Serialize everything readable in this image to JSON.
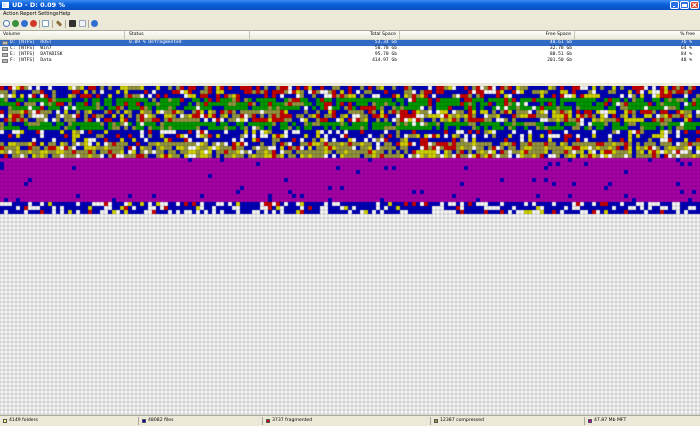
{
  "window": {
    "title": "UD - D: 0.09 %"
  },
  "menu": [
    "Action",
    "Report",
    "Settings",
    "Help"
  ],
  "toolbar": {
    "icons": [
      "analyze-icon",
      "defragment-icon",
      "optimize-icon",
      "stop-icon",
      "report-icon",
      "settings-icon",
      "boot-time-icon",
      "script-icon",
      "help-icon"
    ],
    "colors": {
      "analyze": "#4a7ab8",
      "defrag": "#3a8f3a",
      "optimize": "#2f6fd0",
      "stop": "#d03a2a",
      "report": "#7aa0c8",
      "settings": "#8c6a3a",
      "boot": "#303030",
      "script": "#9aa8b8",
      "help": "#2f6fd0"
    }
  },
  "volumes": {
    "columns": [
      "Volume",
      "Status",
      "Total Space",
      "Free Space",
      "% free"
    ],
    "rows": [
      {
        "volume": "D: [NTFS]  HOST",
        "status": "0.09 % Defragmented",
        "total": "53.34 Gb",
        "free": "40.61 Gb",
        "pct": "76 %",
        "selected": true
      },
      {
        "volume": "C: [NTFS]  Win7",
        "status": "",
        "total": "50.78 Gb",
        "free": "32.78 Gb",
        "pct": "64 %",
        "selected": false
      },
      {
        "volume": "E: [NTFS]  DATADISK",
        "status": "",
        "total": "95.70 Gb",
        "free": "80.51 Gb",
        "pct": "84 %",
        "selected": false
      },
      {
        "volume": "F: [NTFS]  Data",
        "status": "",
        "total": "414.97 Gb",
        "free": "201.50 Gb",
        "pct": "48 %",
        "selected": false
      }
    ]
  },
  "cluster_colors": {
    "free": "#ffffff",
    "system": "#d8d800",
    "files": "#0000c0",
    "fragmented": "#d00000",
    "compressed": "#9a9a40",
    "mft": "#b000b0",
    "green": "#00a000",
    "gray": "#c0c0c0"
  },
  "status": [
    {
      "text": "4149 folders",
      "color": "#ffff80"
    },
    {
      "text": "48082 files",
      "color": "#0000c0"
    },
    {
      "text": "3737 fragmented",
      "color": "#d00000"
    },
    {
      "text": "12387 compressed",
      "color": "#9a9a40"
    },
    {
      "text": "47.87 Mb MFT",
      "color": "#b000b0"
    }
  ]
}
